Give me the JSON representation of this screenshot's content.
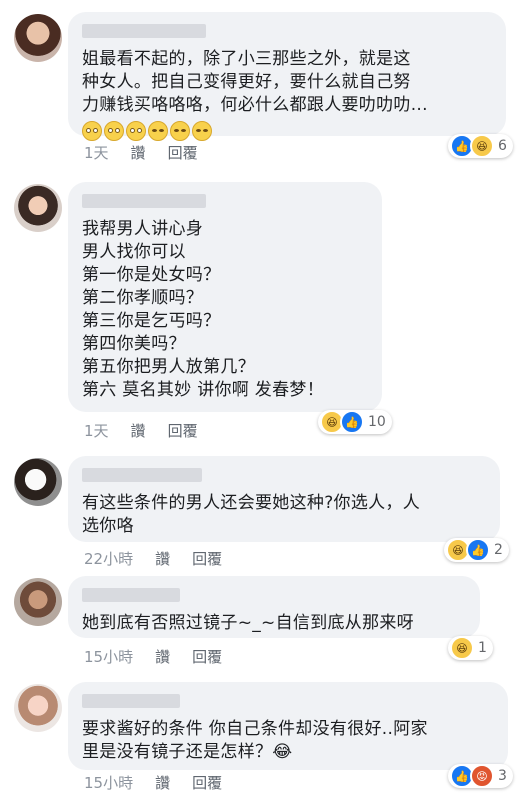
{
  "comments": [
    {
      "text": "姐最看不起的，除了小三那些之外，就是这\n种女人。把自己变得更好，要什么就自己努\n力赚钱买咯咯咯，何必什么都跟人要叻叻叻...",
      "emojis": [
        "rolling-eyes",
        "rolling-eyes",
        "rolling-eyes",
        "disappointed",
        "disappointed",
        "disappointed"
      ],
      "time": "1天",
      "like": "讚",
      "reply": "回覆",
      "reaction_count": "6"
    },
    {
      "text": "我帮男人讲心身\n男人找你可以\n第一你是处女吗？\n第二你孝顺吗？\n第三你是乞丐吗？\n第四你美吗？\n第五你把男人放第几？\n第六 莫名其妙 讲你啊 发春梦！",
      "time": "1天",
      "like": "讚",
      "reply": "回覆",
      "reaction_count": "10"
    },
    {
      "text": "有这些条件的男人还会要她这种?你选人，人\n选你咯",
      "time": "22小時",
      "like": "讚",
      "reply": "回覆",
      "reaction_count": "2"
    },
    {
      "text": "她到底有否照过镜子~_~自信到底从那来呀",
      "time": "15小時",
      "like": "讚",
      "reply": "回覆",
      "reaction_count": "1"
    },
    {
      "text": "要求酱好的条件 你自己条件却没有很好..阿家\n里是没有镜子还是怎样？😂",
      "time": "15小時",
      "like": "讚",
      "reply": "回覆",
      "reaction_count": "3"
    }
  ]
}
